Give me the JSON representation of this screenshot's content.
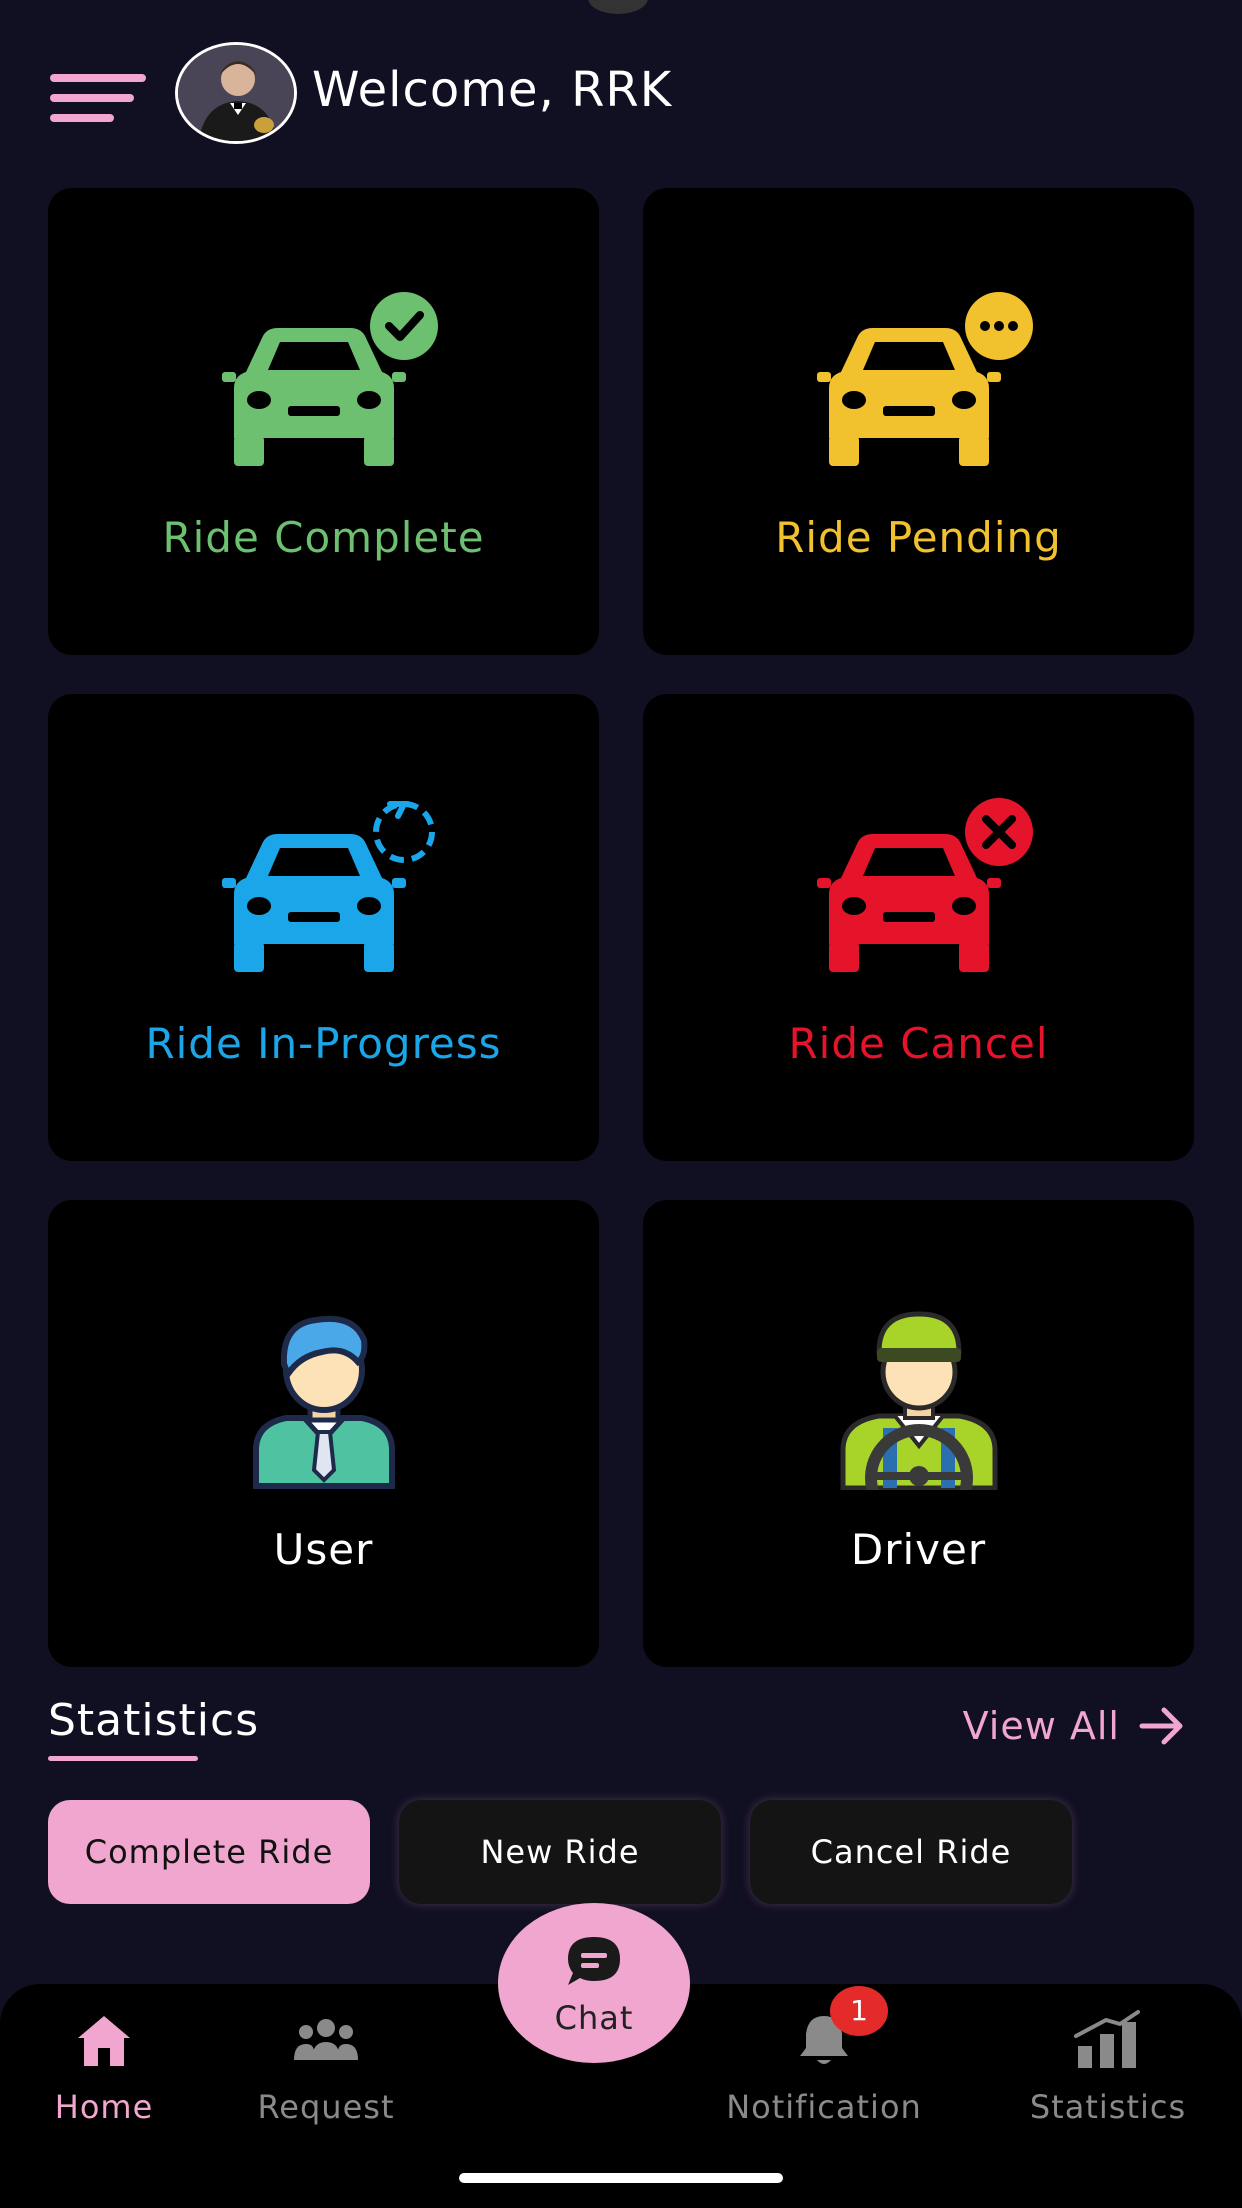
{
  "header": {
    "welcome": "Welcome, RRK"
  },
  "cards": [
    {
      "label": "Ride Complete",
      "color": "#6cc070",
      "icon": "car-complete-icon"
    },
    {
      "label": "Ride Pending",
      "color": "#f2c12e",
      "icon": "car-pending-icon"
    },
    {
      "label": "Ride In-Progress",
      "color": "#1aa6e8",
      "icon": "car-in-progress-icon"
    },
    {
      "label": "Ride Cancel",
      "color": "#e5142b",
      "icon": "car-cancel-icon"
    },
    {
      "label": "User",
      "color": "#ffffff",
      "icon": "user-avatar-icon"
    },
    {
      "label": "Driver",
      "color": "#ffffff",
      "icon": "driver-avatar-icon"
    }
  ],
  "statistics": {
    "title": "Statistics",
    "view_all": "View All",
    "chips": [
      "Complete Ride",
      "New Ride",
      "Cancel Ride"
    ],
    "active_chip": "Complete Ride"
  },
  "bottom_nav": {
    "home": "Home",
    "request": "Request",
    "chat": "Chat",
    "notification": "Notification",
    "notification_badge": "1",
    "statistics": "Statistics",
    "active": "Home"
  },
  "colors": {
    "accent": "#f0a6cf",
    "background": "#110f22",
    "card": "#000000"
  }
}
